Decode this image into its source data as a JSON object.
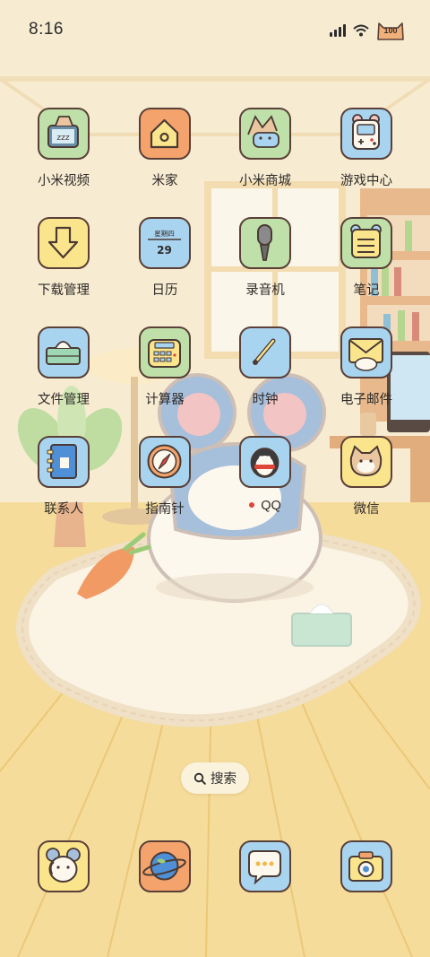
{
  "status_bar": {
    "time": "8:16",
    "battery": "100",
    "icons": [
      "signal-icon",
      "wifi-icon",
      "battery-cat-icon"
    ]
  },
  "apps": [
    {
      "label": "小米视频",
      "icon": "tv-cat-icon",
      "bg": "#bfe0a8"
    },
    {
      "label": "米家",
      "icon": "home-icon",
      "bg": "#f4a36c"
    },
    {
      "label": "小米商城",
      "icon": "shop-cat-icon",
      "bg": "#bfe0a8"
    },
    {
      "label": "游戏中心",
      "icon": "game-console-icon",
      "bg": "#a9d4f0"
    },
    {
      "label": "下载管理",
      "icon": "download-arrow-icon",
      "bg": "#fbe58c"
    },
    {
      "label": "日历",
      "icon": "calendar-icon",
      "bg": "#a9d4f0",
      "calendar_weekday": "星期四",
      "calendar_day": "29"
    },
    {
      "label": "录音机",
      "icon": "microphone-icon",
      "bg": "#bfe0a8"
    },
    {
      "label": "笔记",
      "icon": "notes-icon",
      "bg": "#bfe0a8"
    },
    {
      "label": "文件管理",
      "icon": "tissue-box-icon",
      "bg": "#a9d4f0"
    },
    {
      "label": "计算器",
      "icon": "calculator-icon",
      "bg": "#bfe0a8"
    },
    {
      "label": "时钟",
      "icon": "clock-hand-icon",
      "bg": "#a9d4f0"
    },
    {
      "label": "电子邮件",
      "icon": "envelope-cat-icon",
      "bg": "#a9d4f0"
    },
    {
      "label": "联系人",
      "icon": "contacts-book-icon",
      "bg": "#a9d4f0"
    },
    {
      "label": "指南针",
      "icon": "compass-icon",
      "bg": "#a9d4f0"
    },
    {
      "label": "QQ",
      "icon": "penguin-icon",
      "bg": "#a9d4f0",
      "notification_dot": true
    },
    {
      "label": "微信",
      "icon": "wechat-cat-icon",
      "bg": "#fbe58c"
    }
  ],
  "search": {
    "label": "搜索",
    "icon": "search-icon"
  },
  "dock": [
    {
      "name": "phone-mouse-icon",
      "bg": "#fbe58c"
    },
    {
      "name": "browser-planet-icon",
      "bg": "#f4a36c"
    },
    {
      "name": "messages-bubble-icon",
      "bg": "#a9d4f0"
    },
    {
      "name": "camera-icon",
      "bg": "#a9d4f0"
    }
  ]
}
